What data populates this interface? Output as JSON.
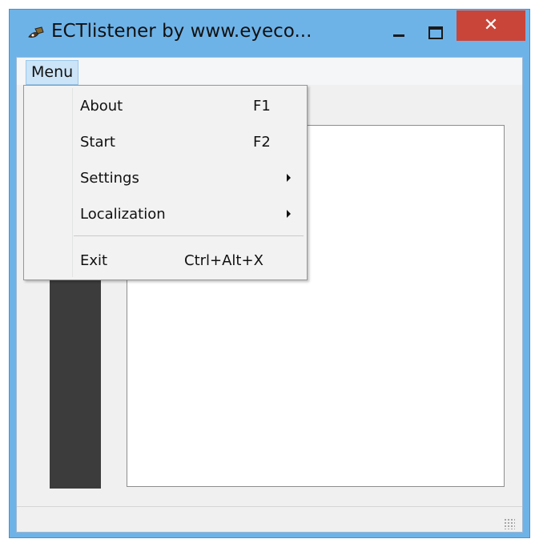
{
  "window": {
    "title": "ECTlistener by www.eyeco...",
    "icon": "app-eye-icon",
    "controls": {
      "minimize": "minimize-icon",
      "maximize": "maximize-icon",
      "close_glyph": "✕"
    }
  },
  "menubar": {
    "items": [
      {
        "label": "Menu"
      }
    ]
  },
  "menu": {
    "items": [
      {
        "label": "About",
        "shortcut": "F1"
      },
      {
        "label": "Start",
        "shortcut": "F2"
      },
      {
        "label": "Settings",
        "submenu": true
      },
      {
        "label": "Localization",
        "submenu": true
      },
      {
        "label": "Exit",
        "shortcut": "Ctrl+Alt+X"
      }
    ]
  },
  "colors": {
    "titlebar": "#6eb3e8",
    "close_button": "#c9453a",
    "menubar_highlight": "#cce4f7",
    "dark_panel": "#3c3c3c"
  }
}
